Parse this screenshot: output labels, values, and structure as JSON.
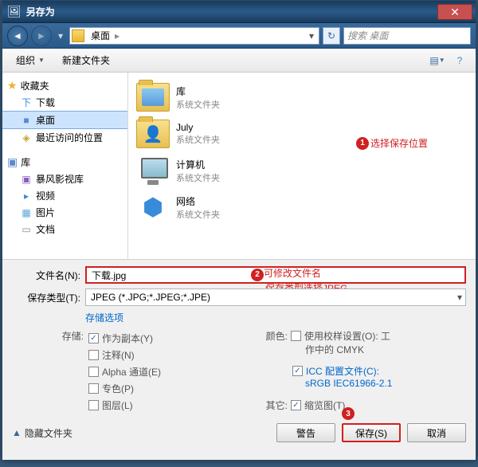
{
  "window": {
    "title": "另存为"
  },
  "nav": {
    "location_label": "桌面",
    "search_placeholder": "搜索 桌面"
  },
  "toolbar": {
    "organize": "组织",
    "newfolder": "新建文件夹"
  },
  "sidebar": {
    "favorites_label": "收藏夹",
    "fav_items": [
      {
        "icon": "下",
        "color": "#3a8ada",
        "label": "下载"
      },
      {
        "icon": "■",
        "color": "#5a8ad0",
        "label": "桌面",
        "selected": true
      },
      {
        "icon": "◈",
        "color": "#c8a030",
        "label": "最近访问的位置"
      }
    ],
    "libraries_label": "库",
    "lib_items": [
      {
        "icon": "▣",
        "color": "#8a5ac0",
        "label": "暴风影视库"
      },
      {
        "icon": "▸",
        "color": "#3a8ada",
        "label": "视频"
      },
      {
        "icon": "▦",
        "color": "#5aa8d8",
        "label": "图片"
      },
      {
        "icon": "▭",
        "color": "#888",
        "label": "文档"
      }
    ]
  },
  "content": {
    "items": [
      {
        "kind": "lib",
        "name": "库",
        "sub": "系统文件夹"
      },
      {
        "kind": "user",
        "name": "July",
        "sub": "系统文件夹"
      },
      {
        "kind": "comp",
        "name": "计算机",
        "sub": "系统文件夹"
      },
      {
        "kind": "net",
        "name": "网络",
        "sub": "系统文件夹"
      }
    ]
  },
  "annotations": {
    "a1": "选择保存位置",
    "a2a": "可修改文件名",
    "a2b": "保存类型选择JPEG"
  },
  "form": {
    "filename_label": "文件名(N):",
    "filename_value": "下载.jpg",
    "type_label": "保存类型(T):",
    "type_value": "JPEG (*.JPG;*.JPEG;*.JPE)",
    "storage_options": "存储选项",
    "storage_label": "存储:",
    "opts_left": [
      {
        "checked": true,
        "label": "作为副本(Y)"
      },
      {
        "checked": false,
        "label": "注释(N)"
      },
      {
        "checked": false,
        "label": "Alpha 通道(E)"
      },
      {
        "checked": false,
        "label": "专色(P)"
      },
      {
        "checked": false,
        "label": "图层(L)"
      }
    ],
    "color_label": "颜色:",
    "color_opt1a": "使用校样设置(O): 工",
    "color_opt1b": "作中的 CMYK",
    "icc_label": "ICC 配置文件(C):",
    "icc_value": "sRGB IEC61966-2.1",
    "other_label": "其它:",
    "thumbnail": "缩览图(T)"
  },
  "buttons": {
    "hide_folders": "隐藏文件夹",
    "warn": "警告",
    "save": "保存(S)",
    "cancel": "取消"
  }
}
